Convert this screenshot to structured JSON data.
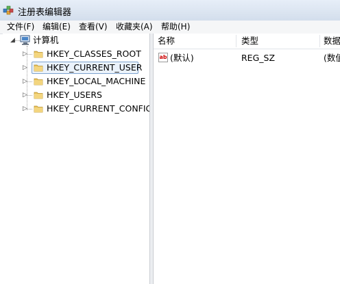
{
  "window": {
    "title": "注册表编辑器"
  },
  "menu": [
    {
      "label": "文件(F)"
    },
    {
      "label": "编辑(E)"
    },
    {
      "label": "查看(V)"
    },
    {
      "label": "收藏夹(A)"
    },
    {
      "label": "帮助(H)"
    }
  ],
  "tree": {
    "root": "计算机",
    "children": [
      {
        "label": "HKEY_CLASSES_ROOT",
        "selected": false
      },
      {
        "label": "HKEY_CURRENT_USER",
        "selected": true
      },
      {
        "label": "HKEY_LOCAL_MACHINE",
        "selected": false
      },
      {
        "label": "HKEY_USERS",
        "selected": false
      },
      {
        "label": "HKEY_CURRENT_CONFIG",
        "selected": false
      }
    ]
  },
  "list": {
    "columns": [
      "名称",
      "类型",
      "数据"
    ],
    "rows": [
      {
        "name": "(默认)",
        "type": "REG_SZ",
        "data": "(数值"
      }
    ]
  },
  "colors": {
    "selection": "#eaf2fb",
    "selection_border": "#7da2ce",
    "folder": "#e8c15a"
  }
}
